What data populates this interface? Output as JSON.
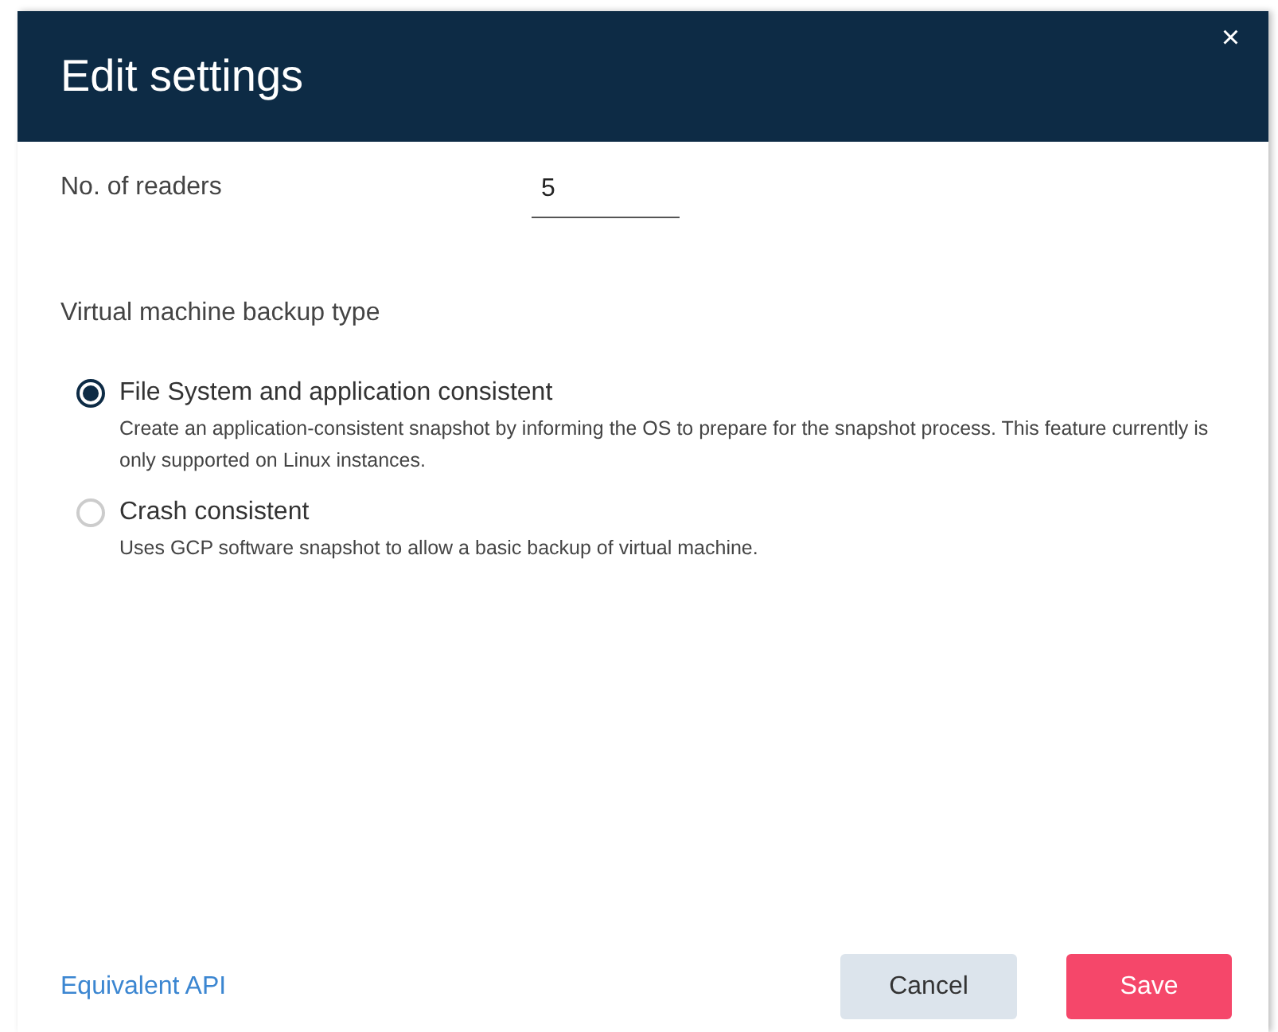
{
  "dialog": {
    "title": "Edit settings",
    "close": "×"
  },
  "readers": {
    "label": "No. of readers",
    "value": "5"
  },
  "backup_type": {
    "label": "Virtual machine backup type",
    "options": [
      {
        "label": "File System and application consistent",
        "description": "Create an application-consistent snapshot by informing the OS to prepare for the snapshot process. This feature currently is only supported on Linux instances.",
        "selected": true
      },
      {
        "label": "Crash consistent",
        "description": "Uses GCP software snapshot to allow a basic backup of virtual machine.",
        "selected": false
      }
    ]
  },
  "footer": {
    "link": "Equivalent API",
    "buttons": [
      {
        "label": "Cancel",
        "kind": "secondary"
      },
      {
        "label": "Save",
        "kind": "primary"
      }
    ]
  }
}
